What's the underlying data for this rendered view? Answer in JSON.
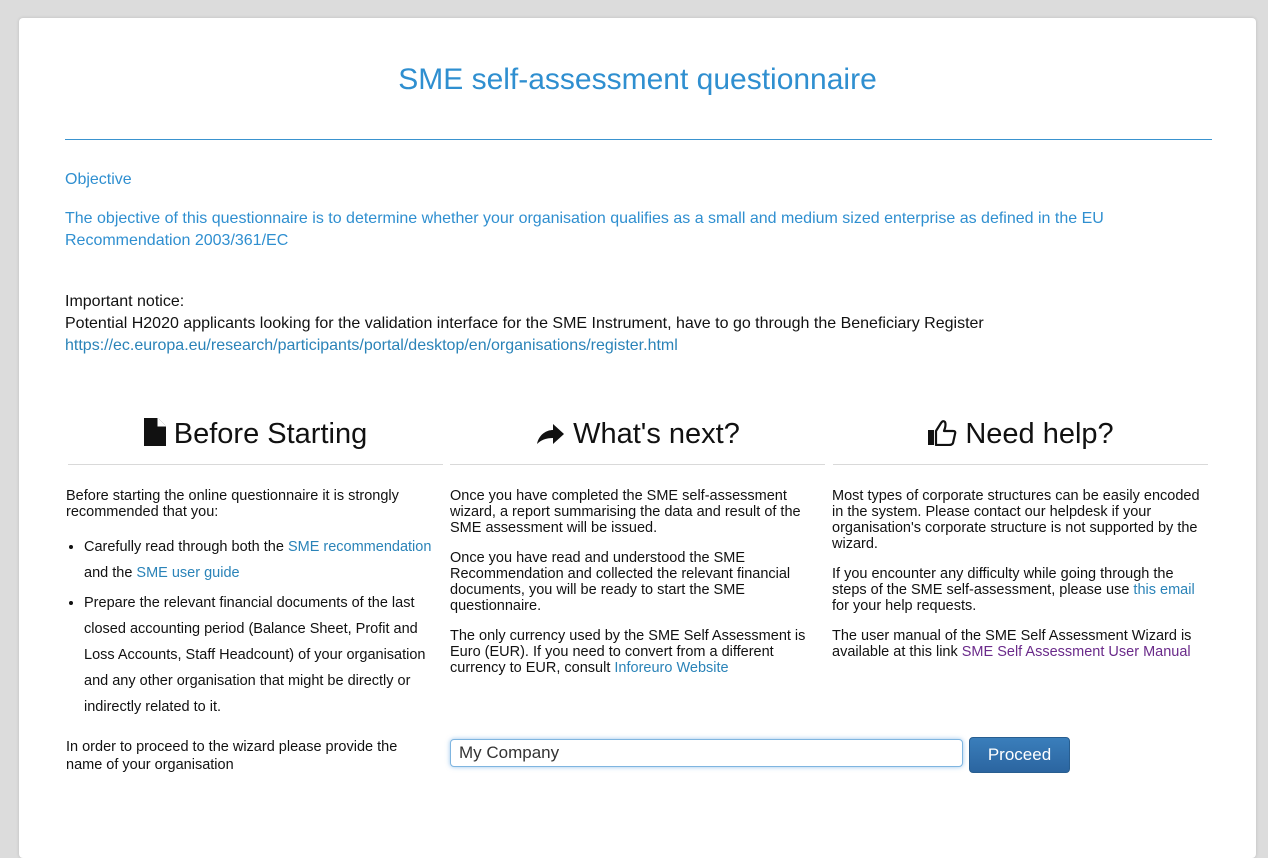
{
  "header": {
    "title": "SME self-assessment questionnaire"
  },
  "objective": {
    "heading": "Objective",
    "text": "The objective of this questionnaire is to determine whether your organisation qualifies as a small and medium sized enterprise as defined in the EU Recommendation 2003/361/EC"
  },
  "notice": {
    "label": "Important notice:",
    "text": "Potential H2020 applicants looking for the validation interface for the SME Instrument, have to go through the Beneficiary Register",
    "link": "https://ec.europa.eu/research/participants/portal/desktop/en/organisations/register.html"
  },
  "before": {
    "heading": "Before Starting",
    "intro": "Before starting the online questionnaire it is strongly recommended that you:",
    "item1_pre": "Carefully read through both the ",
    "item1_link1": "SME recommendation",
    "item1_mid": " and the ",
    "item1_link2": "SME user guide",
    "item2": "Prepare the relevant financial documents of the last closed accounting period (Balance Sheet, Profit and Loss Accounts, Staff Headcount) of your organisation and any other organisation that might be directly or indirectly related to it.",
    "proceed_note": "In order to proceed to the wizard please provide the name of your organisation"
  },
  "next": {
    "heading": "What's next?",
    "p1": "Once you have completed the SME self-assessment wizard, a report summarising the data and result of the SME assessment will be issued.",
    "p2": "Once you have read and understood the SME Recommendation and collected the relevant financial documents, you will be ready to start the SME questionnaire.",
    "p3_pre": "The only currency used by the SME Self Assessment is Euro (EUR). If you need to convert from a different currency to EUR, consult ",
    "p3_link": "Inforeuro Website"
  },
  "help": {
    "heading": "Need help?",
    "p1": "Most types of corporate structures can be easily encoded in the system. Please contact our helpdesk if your organisation's corporate structure is not supported by the wizard.",
    "p2_pre": "If you encounter any difficulty while going through the steps of the SME self-assessment, please use ",
    "p2_link": "this email",
    "p2_post": " for your help requests.",
    "p3_pre": "The user manual of the SME Self Assessment Wizard is available at this link ",
    "p3_link": "SME Self Assessment User Manual"
  },
  "form": {
    "org_value": "My Company",
    "proceed_label": "Proceed"
  },
  "icons": {
    "before": "document-icon",
    "next": "arrow-right-icon",
    "help": "thumbs-up-icon"
  },
  "colors": {
    "accent": "#2f8fd0",
    "link": "#2a83b8",
    "visited_link": "#6a2a8a",
    "button": "#2f6ea8"
  }
}
